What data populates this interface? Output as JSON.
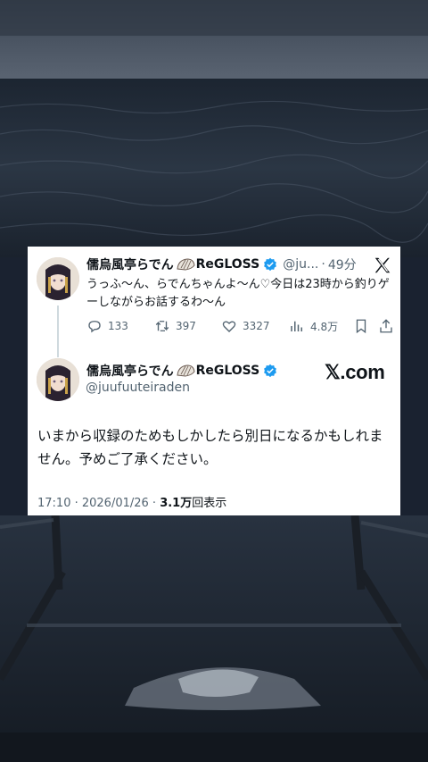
{
  "reply_tweet": {
    "display_name": "儒烏風亭らでん",
    "org_tag": "ReGLOSS",
    "handle_short": "@ju...",
    "separator": "·",
    "time_ago": "49分",
    "text": "うっふ～ん、らでんちゃんよ～ん♡今日は23時から釣りゲーしながらお話するわ～ん",
    "replies": "133",
    "reposts": "397",
    "likes": "3327",
    "views": "4.8万"
  },
  "quoted_tweet": {
    "display_name": "儒烏風亭らでん",
    "org_tag": "ReGLOSS",
    "handle": "@juufuuteiraden",
    "brand": "𝕏.com",
    "text": "いまから収録のためもしかしたら別日になるかもしれません。予めご了承ください。",
    "timestamp": "17:10 · 2026/01/26 · ",
    "view_count": "3.1万",
    "view_label": "回表示"
  },
  "colors": {
    "verified": "#1d9bf0",
    "text": "#0f1419",
    "muted": "#536471"
  },
  "icons": [
    "verified-badge-icon",
    "x-logo-icon",
    "reply-icon",
    "repost-icon",
    "like-icon",
    "views-icon",
    "bookmark-icon",
    "share-icon",
    "shell-icon"
  ]
}
